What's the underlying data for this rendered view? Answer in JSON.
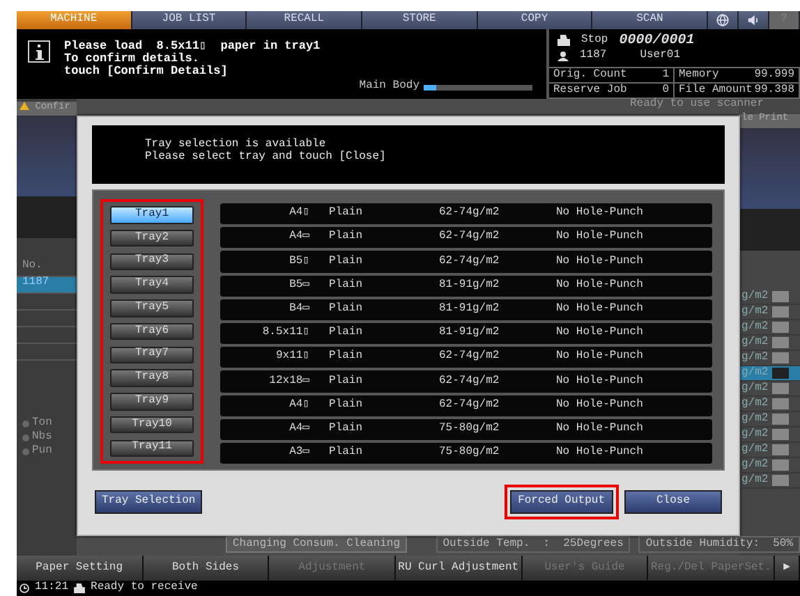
{
  "top_tabs": [
    {
      "kind": "text",
      "label": "MACHINE",
      "selected": true
    },
    {
      "kind": "text",
      "label": "JOB LIST",
      "selected": false
    },
    {
      "kind": "text",
      "label": "RECALL",
      "selected": false
    },
    {
      "kind": "text",
      "label": "STORE",
      "selected": false
    },
    {
      "kind": "text",
      "label": "COPY",
      "selected": false
    },
    {
      "kind": "text",
      "label": "SCAN",
      "selected": false
    },
    {
      "kind": "globe",
      "selected": false
    },
    {
      "kind": "speaker",
      "selected": false
    },
    {
      "kind": "text",
      "label": "?",
      "selected": false
    }
  ],
  "message": {
    "lines": [
      "Please load  8.5x11▯  paper in tray1",
      "To confirm details.",
      "touch [Confirm Details]"
    ]
  },
  "status": {
    "state": "Stop",
    "counter": "0000/0001",
    "user_id": "1187",
    "user": "User01",
    "progress_label": "Main Body",
    "level": 0.12
  },
  "counters": [
    {
      "label": "Orig. Count",
      "value": "1"
    },
    {
      "label": "Memory",
      "value": "99.999"
    },
    {
      "label": "Reserve Job",
      "value": "0"
    },
    {
      "label": "File Amount",
      "value": "99.398"
    }
  ],
  "background": {
    "left_tab": "Confir",
    "scanner_status": "Ready to use scanner",
    "right_tab": "le Print",
    "job_header": "No.",
    "jobs": [
      {
        "text": "1187",
        "selected": true
      }
    ],
    "options": [
      "Ton",
      "Nbs",
      "Pun"
    ],
    "right_rows": [
      {
        "text": "g/m2",
        "selected": false
      },
      {
        "text": "g/m2",
        "selected": false
      },
      {
        "text": "g/m2",
        "selected": false
      },
      {
        "text": "g/m2",
        "selected": false
      },
      {
        "text": "g/m2",
        "selected": false
      },
      {
        "text": "g/m2",
        "selected": true
      },
      {
        "text": "g/m2",
        "selected": false
      },
      {
        "text": "g/m2",
        "selected": false
      },
      {
        "text": "g/m2",
        "selected": false
      },
      {
        "text": "g/m2",
        "selected": false
      },
      {
        "text": "g/m2",
        "selected": false
      },
      {
        "text": "g/m2",
        "selected": false
      },
      {
        "text": "g/m2",
        "selected": false
      }
    ]
  },
  "modal": {
    "lines": [
      "Tray selection is available",
      "Please select tray and touch [Close]"
    ],
    "tray_list_highlighted": true,
    "trays": [
      {
        "label": "Tray1",
        "selected": true
      },
      {
        "label": "Tray2",
        "selected": false
      },
      {
        "label": "Tray3",
        "selected": false
      },
      {
        "label": "Tray4",
        "selected": false
      },
      {
        "label": "Tray5",
        "selected": false
      },
      {
        "label": "Tray6",
        "selected": false
      },
      {
        "label": "Tray7",
        "selected": false
      },
      {
        "label": "Tray8",
        "selected": false
      },
      {
        "label": "Tray9",
        "selected": false
      },
      {
        "label": "Tray10",
        "selected": false
      },
      {
        "label": "Tray11",
        "selected": false
      }
    ],
    "rows": [
      {
        "size": "A4▯",
        "type": "Plain",
        "weight": "62-74g/m2",
        "punch": "No Hole-Punch"
      },
      {
        "size": "A4▭",
        "type": "Plain",
        "weight": "62-74g/m2",
        "punch": "No Hole-Punch"
      },
      {
        "size": "B5▯",
        "type": "Plain",
        "weight": "62-74g/m2",
        "punch": "No Hole-Punch"
      },
      {
        "size": "B5▭",
        "type": "Plain",
        "weight": "81-91g/m2",
        "punch": "No Hole-Punch"
      },
      {
        "size": "B4▭",
        "type": "Plain",
        "weight": "81-91g/m2",
        "punch": "No Hole-Punch"
      },
      {
        "size": "8.5x11▯",
        "type": "Plain",
        "weight": "81-91g/m2",
        "punch": "No Hole-Punch"
      },
      {
        "size": "9x11▯",
        "type": "Plain",
        "weight": "62-74g/m2",
        "punch": "No Hole-Punch"
      },
      {
        "size": "12x18▭",
        "type": "Plain",
        "weight": "62-74g/m2",
        "punch": "No Hole-Punch"
      },
      {
        "size": "A4▯",
        "type": "Plain",
        "weight": "62-74g/m2",
        "punch": "No Hole-Punch"
      },
      {
        "size": "A4▭",
        "type": "Plain",
        "weight": "75-80g/m2",
        "punch": "No Hole-Punch"
      },
      {
        "size": "A3▭",
        "type": "Plain",
        "weight": "75-80g/m2",
        "punch": "No Hole-Punch"
      }
    ],
    "left_button": {
      "label": "Tray Selection",
      "highlighted": false
    },
    "buttons": [
      {
        "label": "Forced Output",
        "highlighted": true
      },
      {
        "label": "Close",
        "highlighted": false
      }
    ]
  },
  "info_bar": {
    "maintenance": "Changing Consum. Cleaning",
    "temperature": "Outside Temp.  :  25Degrees",
    "humidity": "Outside Humidity:  50%"
  },
  "bottom_tabs": [
    {
      "label": "Paper Setting",
      "disabled": false
    },
    {
      "label": "Both Sides",
      "disabled": false
    },
    {
      "label": "Adjustment",
      "disabled": true
    },
    {
      "label": "RU Curl Adjustment",
      "disabled": false
    },
    {
      "label": "User's Guide",
      "disabled": true
    },
    {
      "label": "Reg./Del PaperSet.",
      "disabled": true
    },
    {
      "label": "▶",
      "disabled": false
    }
  ],
  "footer": {
    "time": "11:21",
    "status": "Ready to receive"
  }
}
